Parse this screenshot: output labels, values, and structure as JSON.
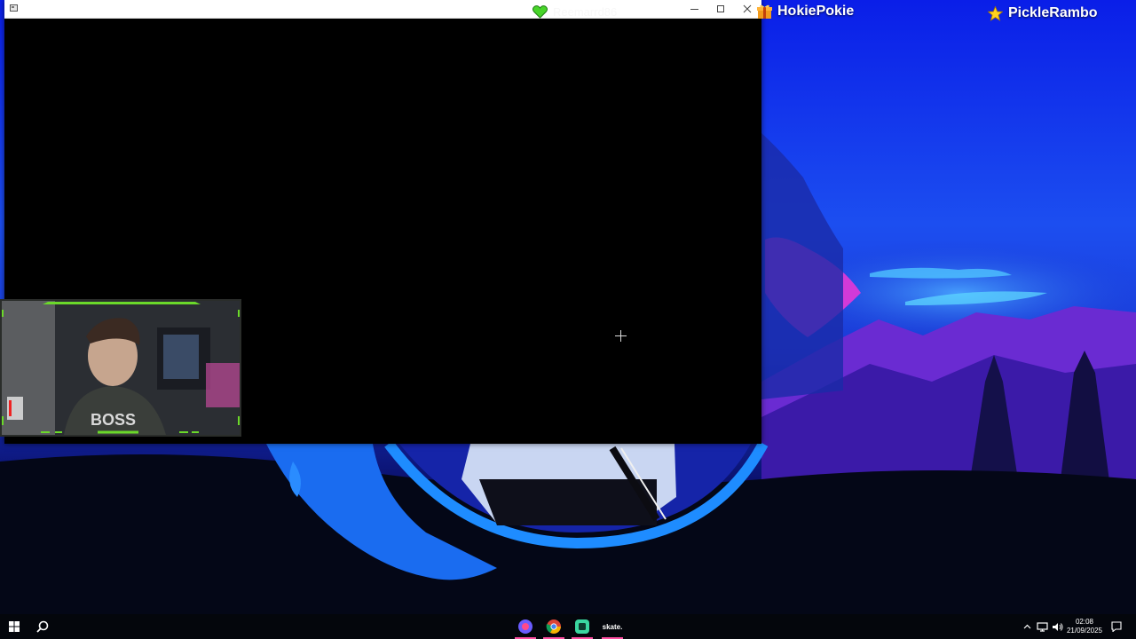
{
  "window": {
    "title": "",
    "buttons": {
      "minimize": "minimize",
      "maximize": "maximize",
      "close": "close"
    }
  },
  "overlay": {
    "heart_alert": {
      "icon": "green-heart-icon",
      "name": "Reemarrd86"
    },
    "gift_alert": {
      "icon": "gift-icon",
      "name": "HokiePokie"
    },
    "star_alert": {
      "icon": "star-icon",
      "name": "PickleRambo"
    },
    "accent_color": "#6bd92a"
  },
  "webcam": {
    "label": "webcam",
    "frame_color": "#6bd92a"
  },
  "taskbar": {
    "start": "windows-start-icon",
    "search": "search-icon",
    "pinned": [
      "app-icon",
      "chrome-icon",
      "streaming-app-icon",
      "skate-app-icon"
    ],
    "pinned_label_4": "skate.",
    "tray": {
      "time": "02:08",
      "date": "21/09/2025",
      "icons": [
        "chevron-up-icon",
        "network-icon",
        "volume-icon",
        "notifications-icon"
      ]
    }
  }
}
